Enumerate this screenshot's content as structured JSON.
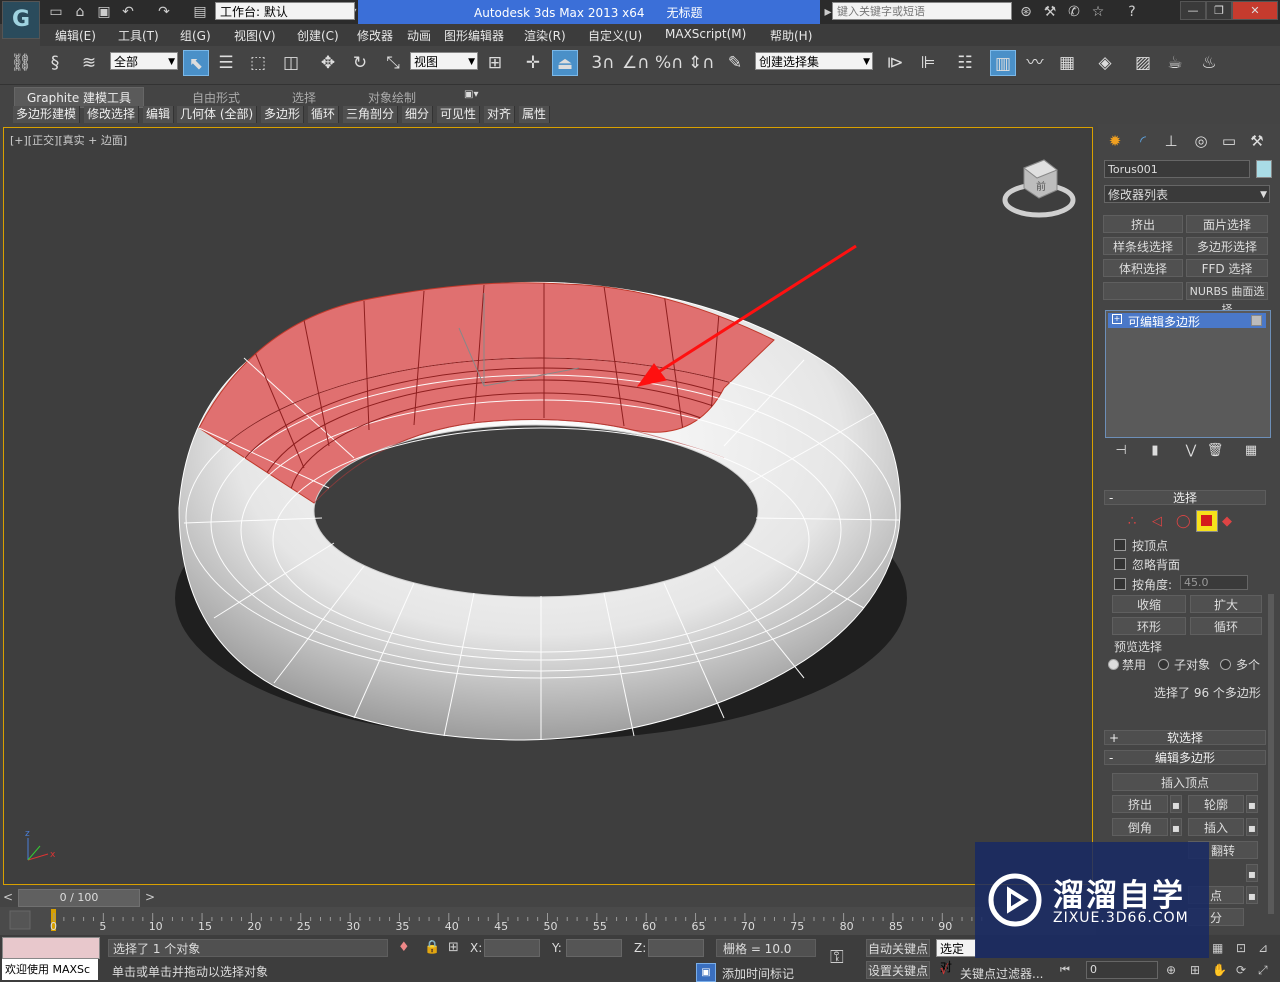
{
  "titlebar": {
    "workspace": "工作台: 默认",
    "app_title": "Autodesk 3ds Max  2013 x64",
    "doc_title": "无标题",
    "search_placeholder": "键入关键字或短语"
  },
  "menu": [
    "编辑(E)",
    "工具(T)",
    "组(G)",
    "视图(V)",
    "创建(C)",
    "修改器",
    "动画",
    "图形编辑器",
    "渲染(R)",
    "自定义(U)",
    "MAXScript(M)",
    "帮助(H)"
  ],
  "toolbar": {
    "selection_filter": "全部",
    "ref_coord": "视图",
    "named_selection": "创建选择集",
    "snap_3": "3",
    "angle_snap": "%"
  },
  "ribbon": {
    "tabs": [
      "Graphite 建模工具",
      "自由形式",
      "选择",
      "对象绘制"
    ],
    "buttons": [
      "多边形建模",
      "修改选择",
      "编辑",
      "几何体 (全部)",
      "多边形",
      "循环",
      "三角剖分",
      "细分",
      "可见性",
      "对齐",
      "属性"
    ]
  },
  "viewport": {
    "label": "[+][正交][真实 + 边面]",
    "viewcube_face": "前",
    "axis_labels": [
      "z",
      "x",
      "y"
    ]
  },
  "command_panel": {
    "object_name": "Torus001",
    "modifier_list": "修改器列表",
    "modifier_buttons": [
      "挤出",
      "面片选择",
      "样条线选择",
      "多边形选择",
      "体积选择",
      "FFD 选择",
      "",
      "NURBS 曲面选择"
    ],
    "stack_item": "可编辑多边形",
    "selection_rollout": "选择",
    "by_vertex": "按顶点",
    "ignore_backfacing": "忽略背面",
    "by_angle": "按角度:",
    "angle_value": "45.0",
    "shrink": "收缩",
    "grow": "扩大",
    "ring": "环形",
    "loop": "循环",
    "preview_selection": "预览选择",
    "preview_options": [
      "禁用",
      "子对象",
      "多个"
    ],
    "selected_info": "选择了 96 个多边形",
    "soft_selection": "软选择",
    "edit_polygons": "编辑多边形",
    "insert_vertex": "插入顶点",
    "extrude": "挤出",
    "outline": "轮廓",
    "bevel": "倒角",
    "inset": "插入",
    "flip": "翻转",
    "partial_1": "分",
    "partial_2": "点"
  },
  "timeline": {
    "frame_counter": "0 / 100",
    "ticks": [
      "0",
      "5",
      "10",
      "15",
      "20",
      "25",
      "30",
      "35",
      "40",
      "45",
      "50",
      "55",
      "60",
      "65",
      "70",
      "75",
      "80",
      "85",
      "90"
    ]
  },
  "status": {
    "maxscript": "欢迎使用 MAXSc",
    "selected": "选择了 1 个对象",
    "prompt": "单击或单击并拖动以选择对象",
    "x_label": "X:",
    "y_label": "Y:",
    "z_label": "Z:",
    "grid": "栅格 = 10.0",
    "add_time_tag": "添加时间标记",
    "auto_key": "自动关键点",
    "set_key": "设置关键点",
    "selected_obj": "选定对",
    "key_filters": "关键点过滤器...",
    "frame": "0"
  },
  "watermark": {
    "title": "溜溜自学",
    "url": "ZIXUE.3D66.COM"
  },
  "colors": {
    "viewport_bg": "#3e3e3e",
    "selection_red": "#e06060",
    "active_border": "#d8a000",
    "titlebar_blue": "#3b6fd8"
  }
}
